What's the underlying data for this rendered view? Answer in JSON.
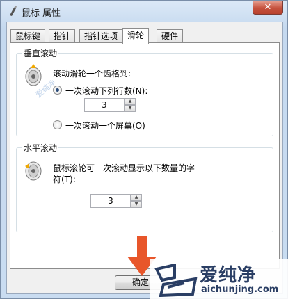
{
  "window": {
    "title": "鼠标 属性",
    "close_glyph": "✕"
  },
  "tabs": [
    {
      "label": "鼠标键",
      "active": false
    },
    {
      "label": "指针",
      "active": false
    },
    {
      "label": "指针选项",
      "active": false
    },
    {
      "label": "滑轮",
      "active": true
    },
    {
      "label": "硬件",
      "active": false
    }
  ],
  "vertical_scroll": {
    "title": "垂直滚动",
    "prompt": "滚动滑轮一个齿格到:",
    "option_lines_label": "一次滚动下列行数(N):",
    "option_lines_selected": true,
    "lines_value": "3",
    "option_screen_label": "一次滚动一个屏幕(O)",
    "option_screen_selected": false
  },
  "horizontal_scroll": {
    "title": "水平滚动",
    "prompt_line1": "鼠标滚轮可一次滚动显示以下数量的字",
    "prompt_line2": "符(T):",
    "chars_value": "3"
  },
  "buttons": {
    "ok_label": "确定"
  },
  "watermark": {
    "brand": "爱纯净",
    "url": "aichunjing.com",
    "faint_text": "爱纯净"
  },
  "colors": {
    "arrow": "#e8562a",
    "watermark_text": "#2a3e64"
  }
}
